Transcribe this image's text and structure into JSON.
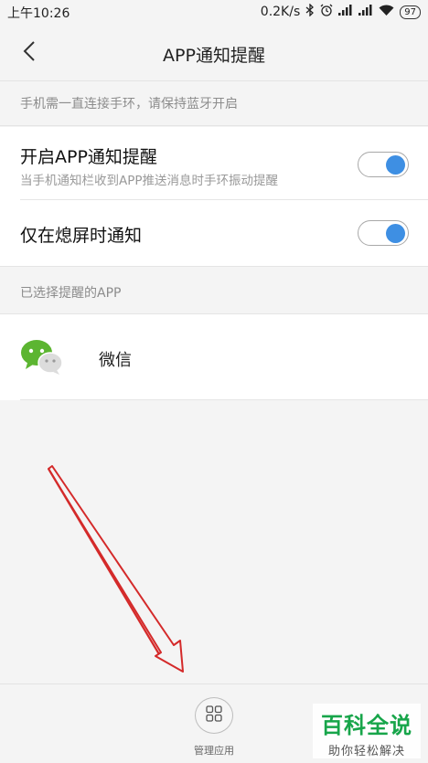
{
  "status_bar": {
    "time": "上午10:26",
    "speed": "0.2K/s",
    "battery": "97",
    "icons": [
      "bluetooth-icon",
      "alarm-icon",
      "signal-icon",
      "signal-icon",
      "wifi-icon",
      "battery-icon"
    ]
  },
  "header": {
    "title": "APP通知提醒",
    "back_icon": "chevron-left-icon"
  },
  "notice": {
    "text": "手机需一直连接手环，请保持蓝牙开启"
  },
  "settings": {
    "app_notify": {
      "title": "开启APP通知提醒",
      "desc": "当手机通知栏收到APP推送消息时手环振动提醒",
      "enabled": true
    },
    "screen_off_only": {
      "title": "仅在熄屏时通知",
      "enabled": true
    }
  },
  "selected_apps": {
    "header": "已选择提醒的APP",
    "items": [
      {
        "name": "微信",
        "icon": "wechat-icon"
      }
    ]
  },
  "bottom_bar": {
    "manage_label": "管理应用",
    "manage_icon": "grid-icon"
  },
  "watermark": {
    "title": "百科全说",
    "subtitle": "助你轻松解决"
  },
  "colors": {
    "accent": "#3e8fe3",
    "background": "#f4f4f4",
    "annotation_arrow": "#d42a2a",
    "watermark_green": "#17a54a"
  }
}
